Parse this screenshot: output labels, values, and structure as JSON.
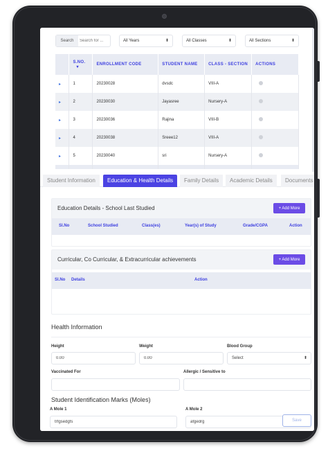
{
  "filters": {
    "search_label": "Search",
    "search_placeholder": "Search for ...",
    "year_select": "All Years",
    "class_select": "All Classes",
    "section_select": "All Sections"
  },
  "table": {
    "headers": [
      "S.NO.",
      "ENROLLMENT CODE",
      "STUDENT NAME",
      "CLASS - SECTION",
      "ACTIONS"
    ],
    "sort_icon": "sort-down-icon",
    "rows": [
      {
        "sno": "1",
        "code": "20230028",
        "name": "dvsdc",
        "class": "VIII-A"
      },
      {
        "sno": "2",
        "code": "20230030",
        "name": "Jayasree",
        "class": "Nursery-A"
      },
      {
        "sno": "3",
        "code": "20230036",
        "name": "Rajina",
        "class": "VIII-B"
      },
      {
        "sno": "4",
        "code": "20230038",
        "name": "Sreee12",
        "class": "VIII-A"
      },
      {
        "sno": "5",
        "code": "20230040",
        "name": "sri",
        "class": "Nursery-A"
      }
    ]
  },
  "tabs": [
    "Student Information",
    "Education & Health Details",
    "Family Details",
    "Academic Details",
    "Documents"
  ],
  "active_tab": "Education & Health Details",
  "education": {
    "title": "Education Details - School Last Studied",
    "add_label": "+ Add More",
    "columns": [
      "Sl.No",
      "School Studied",
      "Class(es)",
      "Year(s) of Study",
      "Grade/CGPA",
      "Action"
    ]
  },
  "curricular": {
    "title": "Curricular, Co Curricular, & Extracurricular achievements",
    "add_label": "+ Add More",
    "columns": [
      "Sl.No",
      "Details",
      "Action"
    ]
  },
  "health": {
    "title": "Health Information",
    "height_label": "Height",
    "height_value": "0.00",
    "weight_label": "Weight",
    "weight_value": "0.00",
    "blood_label": "Blood Group",
    "blood_value": "Select",
    "vaccinated_label": "Vaccinated For",
    "allergic_label": "Allergic / Sensitive to"
  },
  "moles": {
    "title": "Student Identification Marks (Moles)",
    "mole1_label": "A Mole 1",
    "mole1_value": "trfgsedgfs",
    "mole2_label": "A Mole 2",
    "mole2_value": "afgedrg"
  },
  "save_label": "Save",
  "colors": {
    "accent": "#4b43e3",
    "button": "#6b4ce6",
    "header_text": "#3d3fe0",
    "device": "#222327"
  }
}
